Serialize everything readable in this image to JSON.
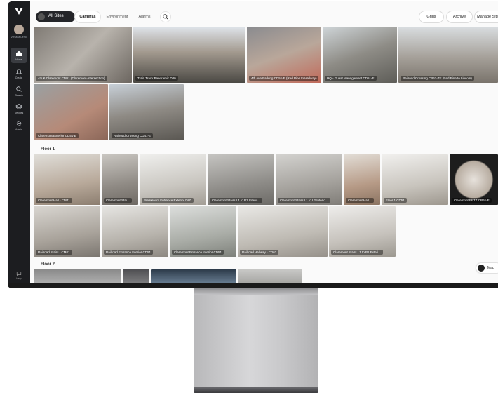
{
  "sidebar": {
    "user": "Verkada\nDemo",
    "items": [
      {
        "label": "Home",
        "icon": "home-icon",
        "active": true
      },
      {
        "label": "Create",
        "icon": "bell-icon",
        "active": false
      },
      {
        "label": "Search",
        "icon": "search-icon",
        "active": false
      },
      {
        "label": "Devices",
        "icon": "layers-icon",
        "active": false
      },
      {
        "label": "Admin",
        "icon": "gear-icon",
        "active": false
      }
    ],
    "help": "Help"
  },
  "topbar": {
    "site_selector": "All Sites",
    "tabs": [
      "Cameras",
      "Environment",
      "Alarms"
    ],
    "active_tab": "Cameras",
    "right_buttons": [
      "Grids",
      "Archive",
      "Manage Sites"
    ]
  },
  "sections": {
    "floor1": "Floor 1",
    "floor2": "Floor 2"
  },
  "top_cameras": [
    "4th & Claremont CM61 (Claremont-Intersection)",
    "Train Track Panoramic D80",
    "4th Ave Parking CD51-E (Red Pine to Hallway)",
    "HQ - Guest Management CD51-E",
    "Railroad Crossing CB61-TE (Red Pine to Lincoln)",
    "Claremont Exterior CD51-E",
    "Railroad Crossing CD41-E"
  ],
  "floor1_cameras": [
    "Claremont Hall - CM41",
    "Claremont Stai...",
    "Breakroom Entrance Exterior D80",
    "Claremont Stairs L1 to P1 Interio...",
    "Claremont Stairs L1 to L2 Interio...",
    "Claremont Hall...",
    "Floor 1 CD51",
    "Claremont EPTZ CR61-E",
    "Railroad Stairs - CM41",
    "Railroad Entrance Interior CD51",
    "Claremont Entrance Interior CD51",
    "Railroad Hallway - CD62",
    "Claremont Stairs L1 to P1 Exteri..."
  ],
  "map_button": "Map",
  "colors": {
    "sidebar": "#1c1d20",
    "accent": "#242529",
    "background": "#fafafa"
  }
}
